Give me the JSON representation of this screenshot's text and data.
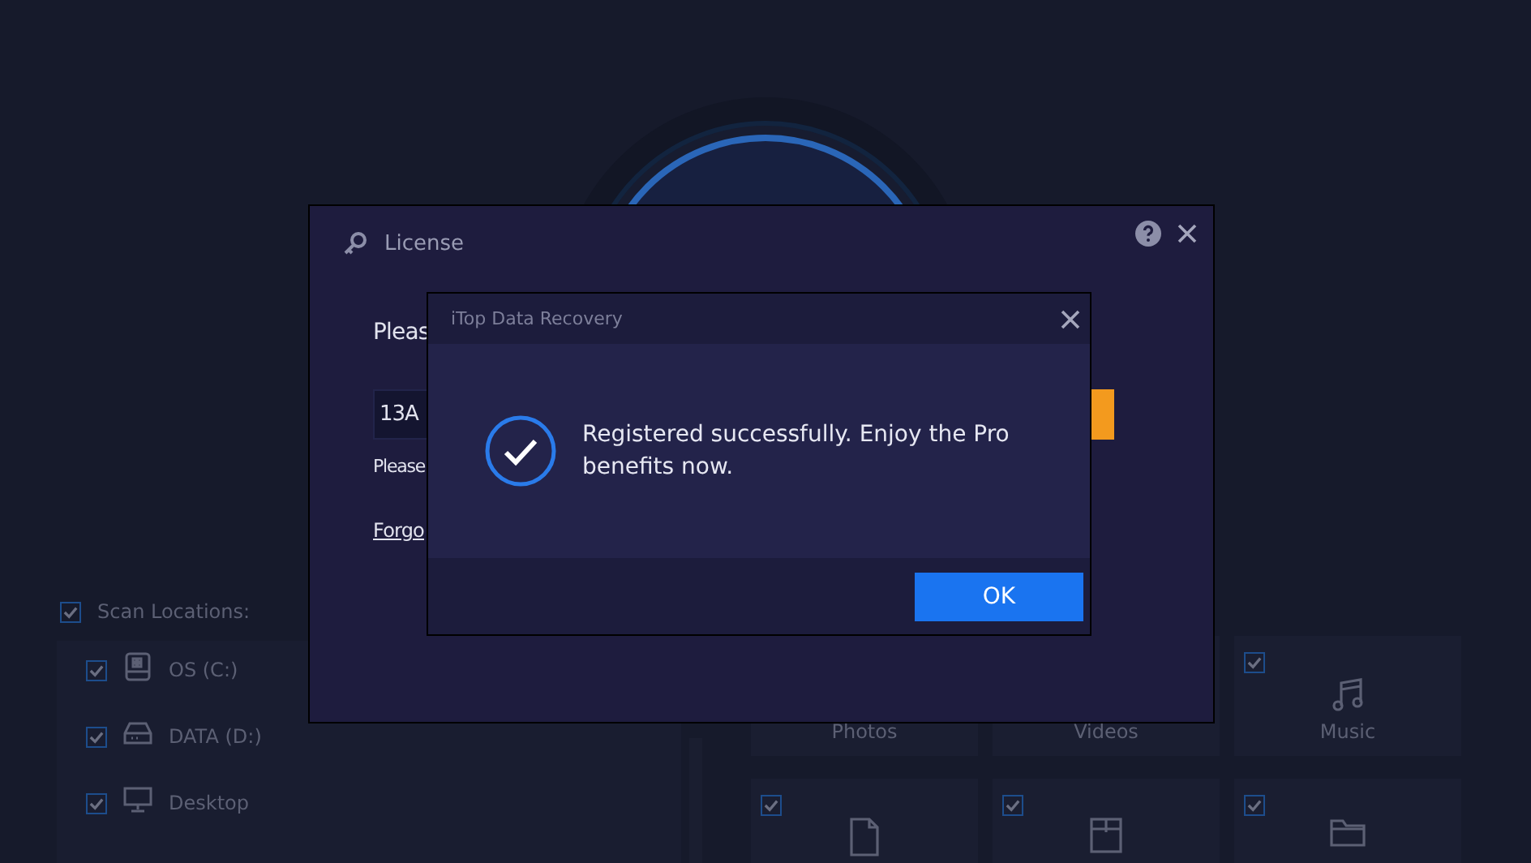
{
  "scan_locations": {
    "label": "Scan Locations:",
    "checked": true,
    "items": [
      {
        "label": "OS (C:)",
        "checked": true,
        "kind": "system-drive"
      },
      {
        "label": "DATA (D:)",
        "checked": true,
        "kind": "drive"
      },
      {
        "label": "Desktop",
        "checked": true,
        "kind": "desktop"
      }
    ]
  },
  "file_types": [
    {
      "label": "Photos",
      "kind": "photo"
    },
    {
      "label": "Videos",
      "kind": "video"
    },
    {
      "label": "Music",
      "checked": true,
      "kind": "music"
    },
    {
      "checked": true,
      "kind": "document"
    },
    {
      "checked": true,
      "kind": "archive"
    },
    {
      "checked": true,
      "kind": "folder"
    }
  ],
  "license_dialog": {
    "title": "License",
    "prompt": "Pleas",
    "code_field": {
      "value": "13A"
    },
    "hint": "Please",
    "link": "Forgo"
  },
  "message_dialog": {
    "title": "iTop Data Recovery",
    "message": "Registered successfully. Enjoy the Pro benefits now.",
    "button": "OK"
  }
}
